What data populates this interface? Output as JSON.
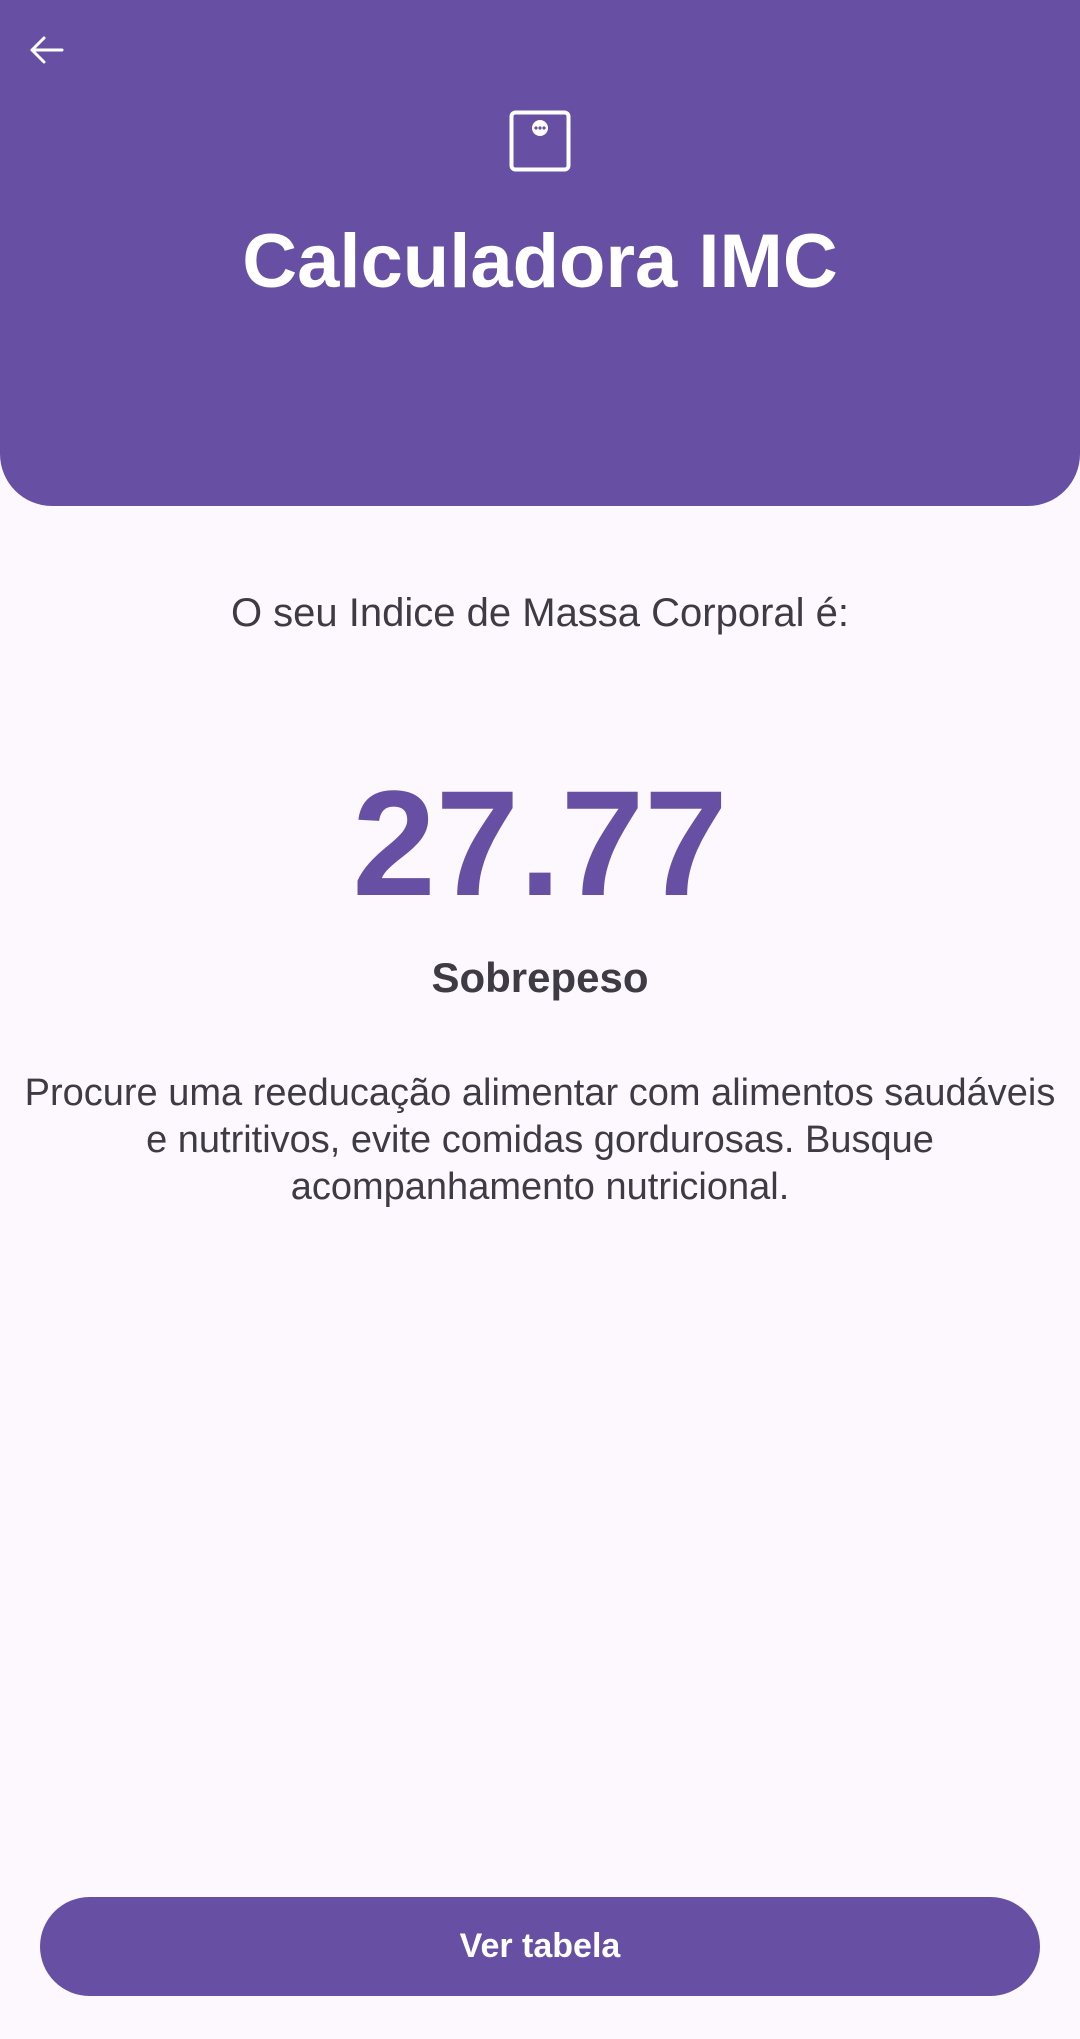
{
  "header": {
    "title": "Calculadora IMC",
    "back_icon": "arrow-left-icon",
    "logo_icon": "scale-icon",
    "background_color": "#6750a4"
  },
  "result": {
    "intro": "O seu Indice de Massa Corporal é:",
    "value": "27.77",
    "category": "Sobrepeso",
    "advice": "Procure uma reeducação alimentar com alimentos saudáveis e nutritivos, evite comidas gordurosas. Busque acompanhamento nutricional.",
    "value_color": "#6750a4"
  },
  "actions": {
    "view_table_label": "Ver tabela"
  }
}
